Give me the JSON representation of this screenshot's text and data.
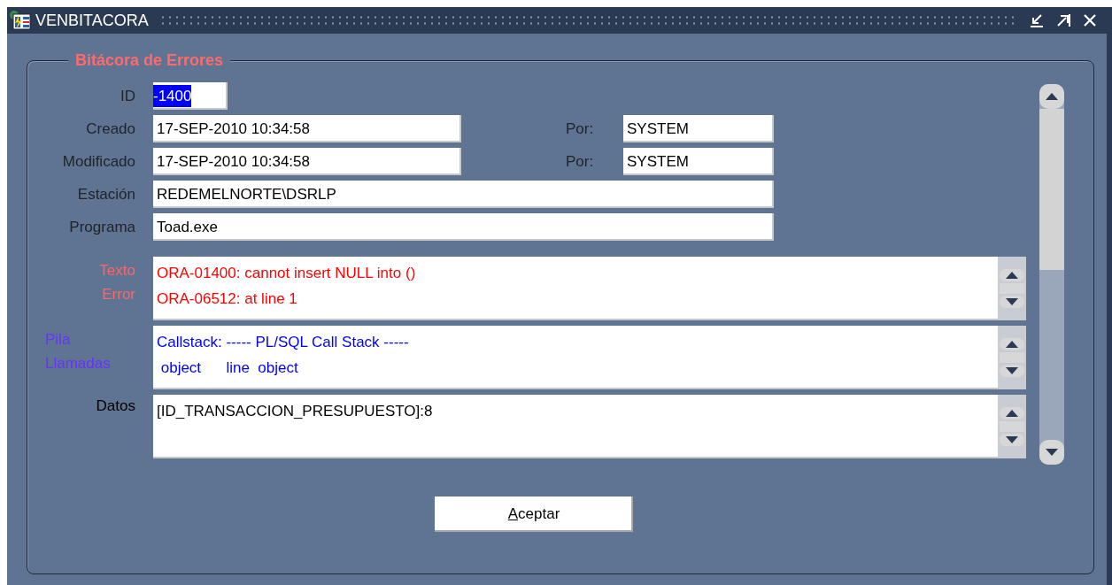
{
  "window": {
    "title": "VENBITACORA"
  },
  "frame_title": "Bitácora de Errores",
  "id_field": {
    "label": "ID",
    "value": "-1400",
    "text_selected": true
  },
  "audit_rows": [
    {
      "label": "Creado",
      "value": "17-SEP-2010 10:34:58",
      "by_label": "Por:",
      "by_value": "SYSTEM"
    },
    {
      "label": "Modificado",
      "value": "17-SEP-2010 10:34:58",
      "by_label": "Por:",
      "by_value": "SYSTEM"
    }
  ],
  "info_rows": [
    {
      "label": "Estación",
      "value": "REDEMELNORTE\\DSRLP"
    },
    {
      "label": "Programa",
      "value": "Toad.exe"
    }
  ],
  "text_areas": [
    {
      "label_lines": [
        "Texto",
        "Error"
      ],
      "color": "#ff0000",
      "lines": [
        "ORA-01400: cannot insert NULL into ()",
        "ORA-06512: at line 1"
      ]
    },
    {
      "label_lines": [
        "Pila",
        "Llamadas"
      ],
      "color": "#0000ff",
      "lines": [
        "Callstack: ----- PL/SQL Call Stack -----",
        " object      line  object"
      ]
    },
    {
      "label_lines": [
        "Datos"
      ],
      "color": "#000000",
      "lines": [
        "[ID_TRANSACCION_PRESUPUESTO]:8"
      ]
    }
  ],
  "accept_button": {
    "label": "Aceptar"
  }
}
